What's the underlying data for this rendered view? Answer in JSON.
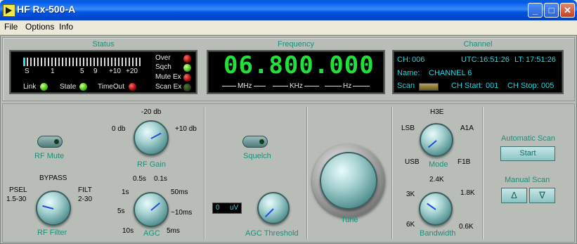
{
  "window": {
    "title": "HF Rx-500-A",
    "min": "_",
    "max": "□",
    "close": "✕"
  },
  "menu": [
    "File",
    "Options",
    "Info"
  ],
  "status": {
    "title": "Status",
    "scale": [
      "S",
      "1",
      "5",
      "9",
      "+10",
      "+20"
    ],
    "indicators": {
      "link": "Link",
      "state": "State",
      "timeout": "TimeOut"
    },
    "flags": [
      "Over",
      "Sqch",
      "Mute Ex",
      "Scan Ex"
    ]
  },
  "frequency": {
    "title": "Frequency",
    "value": "06.800.000",
    "units": [
      "MHz",
      "KHz",
      "Hz"
    ]
  },
  "channel": {
    "title": "Channel",
    "ch_label": "CH:",
    "ch_value": "006",
    "utc_label": "UTC:",
    "utc_value": "16:51:26",
    "lt_label": "LT:",
    "lt_value": "17:51:26",
    "name_label": "Name:",
    "name_value": "CHANNEL 6",
    "scan_label": "Scan",
    "start_label": "CH Start:",
    "start_value": "001",
    "stop_label": "CH Stop:",
    "stop_value": "005"
  },
  "controls": {
    "rf_mute": "RF Mute",
    "rf_gain": {
      "label": "RF Gain",
      "scale": [
        "-20 db",
        "0 db",
        "+10 db"
      ]
    },
    "rf_filter": {
      "label": "RF Filter",
      "scale": [
        "BYPASS",
        "PSEL",
        "1.5-30",
        "FILT",
        "2-30"
      ]
    },
    "agc": {
      "label": "AGC",
      "scale": [
        "0.5s",
        "0.1s",
        "1s",
        "50ms",
        "5s",
        "~10ms",
        "10s",
        "5ms"
      ]
    },
    "squelch": "Squelch",
    "agc_threshold": {
      "label": "AGC Threshold",
      "value": "0",
      "unit": "uV"
    },
    "tune": "Tune",
    "mode": {
      "label": "Mode",
      "scale": [
        "H3E",
        "LSB",
        "A1A",
        "USB",
        "F1B"
      ]
    },
    "bandwidth": {
      "label": "Bandwidth",
      "scale": [
        "2.4K",
        "3K",
        "1.8K",
        "6K",
        "0.6K"
      ]
    },
    "auto_scan": {
      "label": "Automatic Scan",
      "button": "Start"
    },
    "manual_scan": {
      "label": "Manual Scan",
      "up": "Δ",
      "down": "∇"
    }
  }
}
